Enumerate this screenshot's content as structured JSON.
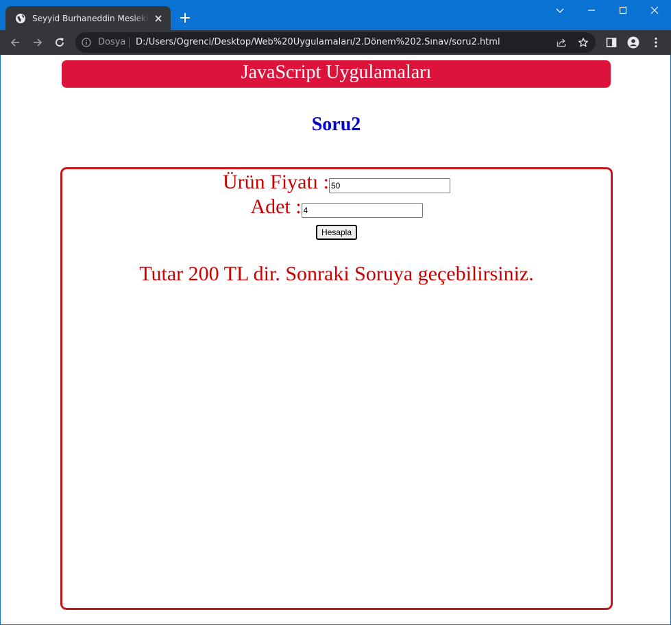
{
  "browser": {
    "tab_title": "Seyyid Burhaneddin Mesleki ve Teknik Anadolu Lisesi",
    "address_scheme": "Dosya",
    "address_url": "D:/Users/Ogrenci/Desktop/Web%20Uygulamaları/2.Dönem%202.Sınav/soru2.html",
    "chrome_color": "#0a72d2",
    "toolbar_color": "#35363a"
  },
  "page": {
    "banner_title": "JavaScript Uygulamaları",
    "subtitle": "Soru2",
    "banner_color": "#dc143c",
    "subtitle_color": "#0000cd",
    "text_color": "#cc0000",
    "form": {
      "price_label": "Ürün Fiyatı :",
      "price_value": "50",
      "quantity_label": "Adet :",
      "quantity_value": "4",
      "calculate_button": "Hesapla"
    },
    "result_text": "Tutar 200 TL dir. Sonraki Soruya geçebilirsiniz."
  }
}
